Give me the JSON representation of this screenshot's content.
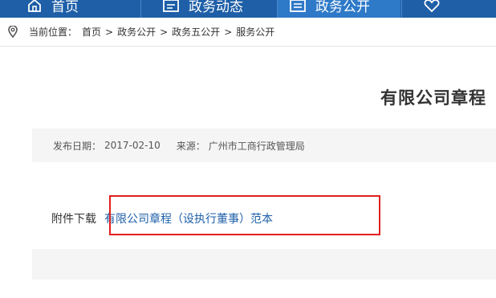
{
  "nav": {
    "items": [
      {
        "label": "首页",
        "icon": "home-icon"
      },
      {
        "label": "政务动态",
        "icon": "news-icon"
      },
      {
        "label": "政务公开",
        "icon": "disclosure-icon",
        "active": true
      },
      {
        "label": "",
        "icon": "heart-icon"
      }
    ],
    "bg_color": "#1e5fa8",
    "active_color": "#2e79c8"
  },
  "breadcrumb": {
    "icon": "location-pin-icon",
    "prefix": "当前位置：",
    "items": [
      "首页",
      "政务公开",
      "政务五公开",
      "服务公开"
    ],
    "separator": ">"
  },
  "article": {
    "title": "有限公司章程",
    "date_label": "发布日期：",
    "date": "2017-02-10",
    "source_label": "来源：",
    "source": "广州市工商行政管理局",
    "attachment_label": "附件下载",
    "attachment_link": "有限公司章程（设执行董事）范本"
  },
  "highlight_color": "#e02020"
}
